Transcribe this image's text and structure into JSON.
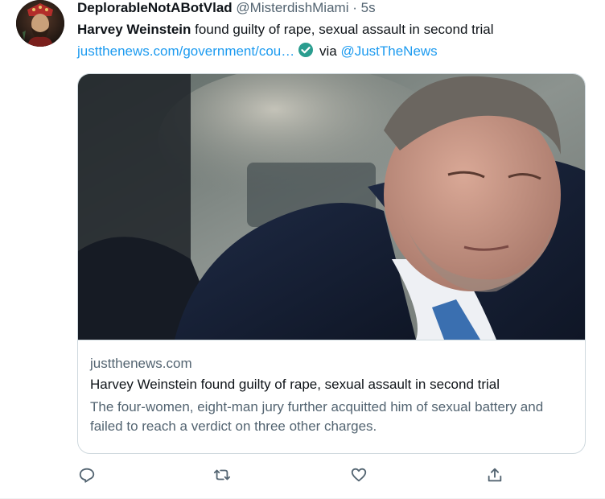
{
  "tweet": {
    "display_name": "DeplorableNotABotVlad",
    "handle": "@MisterdishMiami",
    "separator": "·",
    "time": "5s",
    "text_bold": "Harvey Weinstein",
    "text_rest": " found guilty of rape, sexual assault in second trial",
    "link_text": "justthenews.com/government/cou…",
    "via_text": " via ",
    "via_handle": "@JustTheNews"
  },
  "card": {
    "domain": "justthenews.com",
    "title": "Harvey Weinstein found guilty of rape, sexual assault in second trial",
    "description": "The four-women, eight-man jury further acquitted him of sexual battery and failed to reach a verdict on three other charges."
  },
  "icons": {
    "avatar": "avatar",
    "more": "more-horizontal-icon",
    "verified": "verified-badge-icon",
    "reply": "reply-icon",
    "retweet": "retweet-icon",
    "like": "like-heart-icon",
    "share": "share-icon"
  },
  "colors": {
    "link": "#1d9bf0",
    "secondary_text": "#536471",
    "primary_text": "#0f1419",
    "border": "#cfd9de"
  }
}
